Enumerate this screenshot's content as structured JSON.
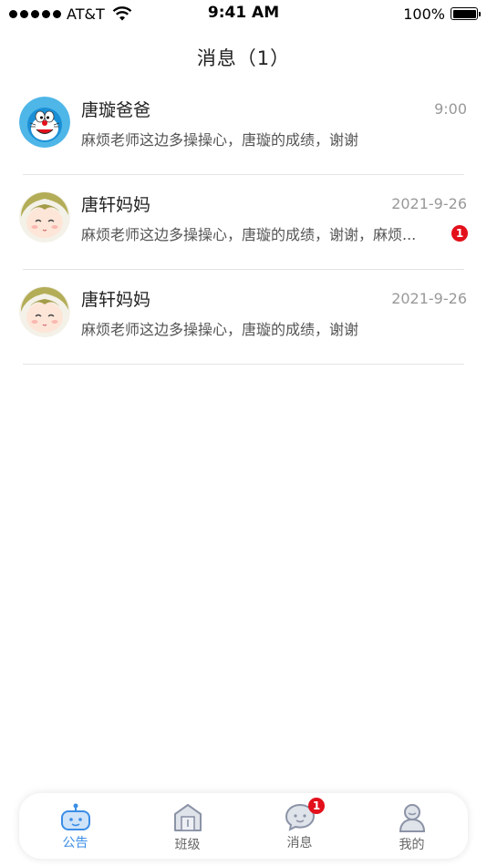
{
  "status_bar": {
    "carrier": "AT&T",
    "time": "9:41 AM",
    "battery": "100%"
  },
  "header": {
    "title": "消息（1）"
  },
  "messages": [
    {
      "name": "唐璇爸爸",
      "time": "9:00",
      "preview": "麻烦老师这边多操操心，唐璇的成绩，谢谢",
      "unread": ""
    },
    {
      "name": "唐轩妈妈",
      "time": "2021-9-26",
      "preview": "麻烦老师这边多操操心，唐璇的成绩，谢谢，麻烦...",
      "unread": "1"
    },
    {
      "name": "唐轩妈妈",
      "time": "2021-9-26",
      "preview": "麻烦老师这边多操操心，唐璇的成绩，谢谢",
      "unread": ""
    }
  ],
  "tabs": [
    {
      "label": "公告",
      "icon": "bot-icon",
      "active": true
    },
    {
      "label": "班级",
      "icon": "class-icon",
      "active": false
    },
    {
      "label": "消息",
      "icon": "chat-icon",
      "active": false,
      "badge": "1"
    },
    {
      "label": "我的",
      "icon": "profile-icon",
      "active": false
    }
  ],
  "colors": {
    "accent": "#3a8ee6",
    "badge": "#e3101b",
    "muted": "#999999"
  }
}
